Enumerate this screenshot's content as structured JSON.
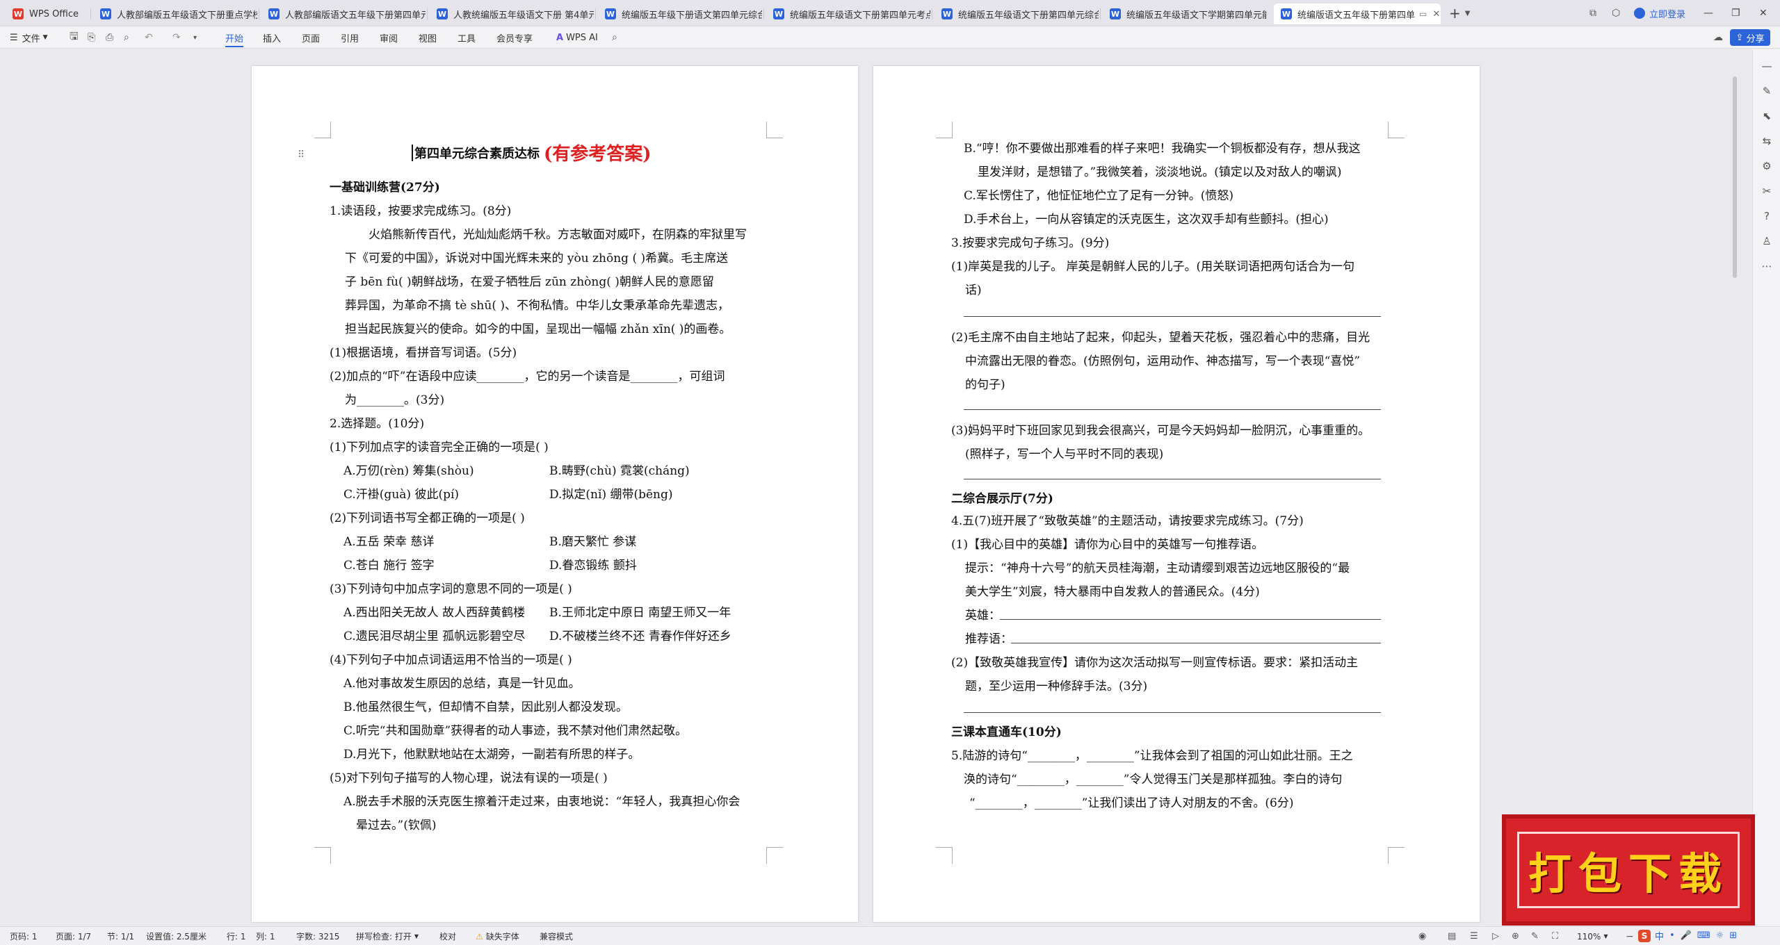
{
  "tabs": [
    {
      "icon": "W",
      "label": "WPS Office"
    },
    {
      "icon": "W",
      "label": "人教部编版五年级语文下册重点学校5"
    },
    {
      "icon": "W",
      "label": "人教部编版语文五年级下册第四单元"
    },
    {
      "icon": "W",
      "label": "人教统编版五年级语文下册 第4单元"
    },
    {
      "icon": "W",
      "label": "统编版五年级下册语文第四单元综合"
    },
    {
      "icon": "W",
      "label": "统编版五年级语文下册第四单元考点"
    },
    {
      "icon": "W",
      "label": "统编版五年级语文下册第四单元综合"
    },
    {
      "icon": "W",
      "label": "统编版五年级语文下学期第四单元能"
    },
    {
      "icon": "W",
      "label": "统编版语文五年级下册第四单"
    }
  ],
  "window": {
    "login": "立即登录",
    "new_tab": "+"
  },
  "toolbar": {
    "file": "文件",
    "menus": [
      "开始",
      "插入",
      "页面",
      "引用",
      "审阅",
      "视图",
      "工具",
      "会员专享"
    ],
    "wps_ai": "WPS AI",
    "share": "分享"
  },
  "doc": {
    "title": "第四单元综合素质达标",
    "title_red": "(有参考答案)",
    "left": [
      "一基础训练营(27分)",
      "1.读语段，按要求完成练习。(8分)",
      "火焰熊新传百代，光灿灿彪炳千秋。方志敏面对威吓，在阴森的牢狱里写",
      "下《可爱的中国》，诉说对中国光辉未来的 yòu zhōng (          )希冀。毛主席送",
      "子 bēn fù(          )朝鲜战场，在爱子牺牲后 zūn zhòng(          )朝鲜人民的意愿留",
      "葬异国，为革命不搞 tè shū(          )、不徇私情。中华儿女秉承革命先辈遗志，",
      "担当起民族复兴的使命。如今的中国，呈现出一幅幅 zhǎn xīn(          )的画卷。",
      "(1)根据语境，看拼音写词语。(5分)",
      "(2)加点的“吓”在语段中应读________，它的另一个读音是________，可组词",
      "为________。(3分)",
      "2.选择题。(10分)",
      "(1)下列加点字的读音完全正确的一项是(        )",
      "A.万仞(rèn)          筹集(shòu)",
      "B.畴野(chù)      霓裳(cháng)",
      "C.汗褂(guà)          彼此(pí)",
      "D.拟定(nǐ)        绷带(bēng)",
      "(2)下列词语书写全都正确的一项是(        )",
      "A.五岳        荣幸    慈详",
      "B.磨天繁忙    参谋",
      "C.苍白        施行    签字",
      "D.眷恋锻练    颤抖",
      "(3)下列诗句中加点字词的意思不同的一项是(        )",
      "A.西出阳关无故人    故人西辞黄鹤楼",
      "B.王师北定中原日    南望王师又一年",
      "C.遗民泪尽胡尘里    孤帆远影碧空尽",
      "D.不破楼兰终不还    青春作伴好还乡",
      "(4)下列句子中加点词语运用不恰当的一项是(        )",
      "A.他对事故发生原因的总结，真是一针见血。",
      "B.他虽然很生气，但却情不自禁，因此别人都没发现。",
      "C.听完“共和国勋章”获得者的动人事迹，我不禁对他们肃然起敬。",
      "D.月光下，他默默地站在太湖旁，一副若有所思的样子。",
      "(5)对下列句子描写的人物心理，说法有误的一项是(        )",
      "A.脱去手术服的沃克医生擦着汗走过来，由衷地说：“年轻人，我真担心你会",
      "晕过去。”(钦佩)"
    ],
    "right": [
      "B.“哼！你不要做出那难看的样子来吧！我确实一个铜板都没有存，想从我这",
      "里发洋财，是想错了。”我微笑着，淡淡地说。(镇定以及对敌人的嘲讽)",
      "C.军长愣住了，他怔怔地伫立了足有一分钟。(愤怒)",
      "D.手术台上，一向从容镇定的沃克医生，这次双手却有些颤抖。(担心)",
      "3.按要求完成句子练习。(9分)",
      "(1)岸英是我的儿子。    岸英是朝鲜人民的儿子。(用关联词语把两句话合为一句",
      "话)",
      "(2)毛主席不由自主地站了起来，仰起头，望着天花板，强忍着心中的悲痛，目光",
      "中流露出无限的眷恋。(仿照例句，运用动作、神态描写，写一个表现“喜悦”",
      "的句子)",
      "(3)妈妈平时下班回家见到我会很高兴，可是今天妈妈却一脸阴沉，心事重重的。",
      "(照样子，写一个人与平时不同的表现)",
      "二综合展示厅(7分)",
      "4.五(7)班开展了“致敬英雄”的主题活动，请按要求完成练习。(7分)",
      "(1)【我心目中的英雄】请你为心目中的英雄写一句推荐语。",
      "提示：“神舟十六号”的航天员桂海潮，主动请缨到艰苦边远地区服役的“最",
      "美大学生”刘宸，特大暴雨中自发救人的普通民众。(4分)",
      "英雄：",
      "推荐语：",
      "(2)【致敬英雄我宣传】请你为这次活动拟写一则宣传标语。要求：紧扣活动主",
      "题，至少运用一种修辞手法。(3分)",
      "三课本直通车(10分)",
      "5.陆游的诗句“________，________”让我体会到了祖国的河山如此壮丽。王之",
      "涣的诗句“________，________”令人觉得玉门关是那样孤独。李白的诗句",
      "“________，________”让我们读出了诗人对朋友的不舍。(6分)"
    ]
  },
  "status": {
    "page": "页码: 1",
    "pages": "页面: 1/7",
    "section": "节: 1/1",
    "setting": "设置值: 2.5厘米",
    "row": "行: 1",
    "col": "列: 1",
    "words": "字数: 3215",
    "spell": "拼写检查: 打开",
    "proof": "校对",
    "missing_font": "缺失字体",
    "compat": "兼容模式",
    "zoom": "110%"
  },
  "promo": {
    "text": "打包下载"
  },
  "ime": {
    "lang": "中"
  }
}
